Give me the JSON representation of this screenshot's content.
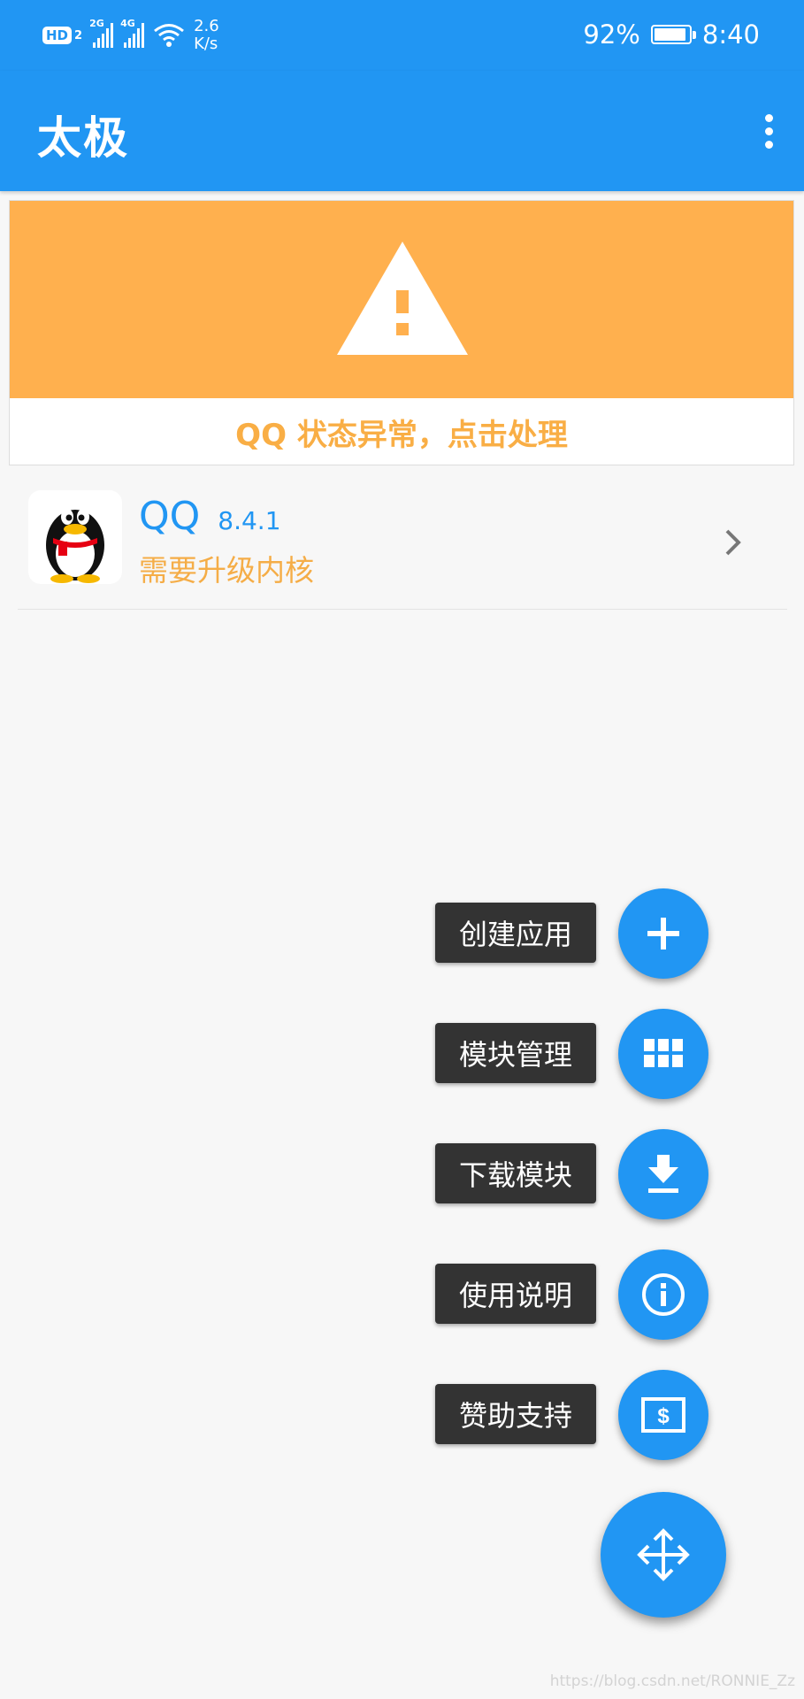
{
  "status_bar": {
    "hd_label": "HD",
    "hd_sub": "2",
    "net1": "2G",
    "net2": "4G",
    "speed_value": "2.6",
    "speed_unit": "K/s",
    "battery_text": "92%",
    "battery_level": 92,
    "time": "8:40"
  },
  "app_bar": {
    "title": "太极",
    "menu_icon": "more-vert-icon"
  },
  "warning": {
    "icon": "warning-icon",
    "message": "QQ 状态异常，点击处理"
  },
  "app_list": [
    {
      "name": "QQ",
      "version": "8.4.1",
      "status": "需要升级内核",
      "icon": "qq-penguin-icon"
    }
  ],
  "fab_menu": [
    {
      "label": "创建应用",
      "icon": "plus-icon"
    },
    {
      "label": "模块管理",
      "icon": "grid-icon"
    },
    {
      "label": "下载模块",
      "icon": "download-icon"
    },
    {
      "label": "使用说明",
      "icon": "info-icon"
    },
    {
      "label": "赞助支持",
      "icon": "money-icon"
    }
  ],
  "fab_main": {
    "icon": "move-arrows-icon"
  },
  "watermark": "https://blog.csdn.net/RONNIE_Zz",
  "colors": {
    "primary": "#2196f3",
    "warning": "#ffb04e",
    "accent_text": "#f5ad47",
    "label_bg": "#333333"
  }
}
